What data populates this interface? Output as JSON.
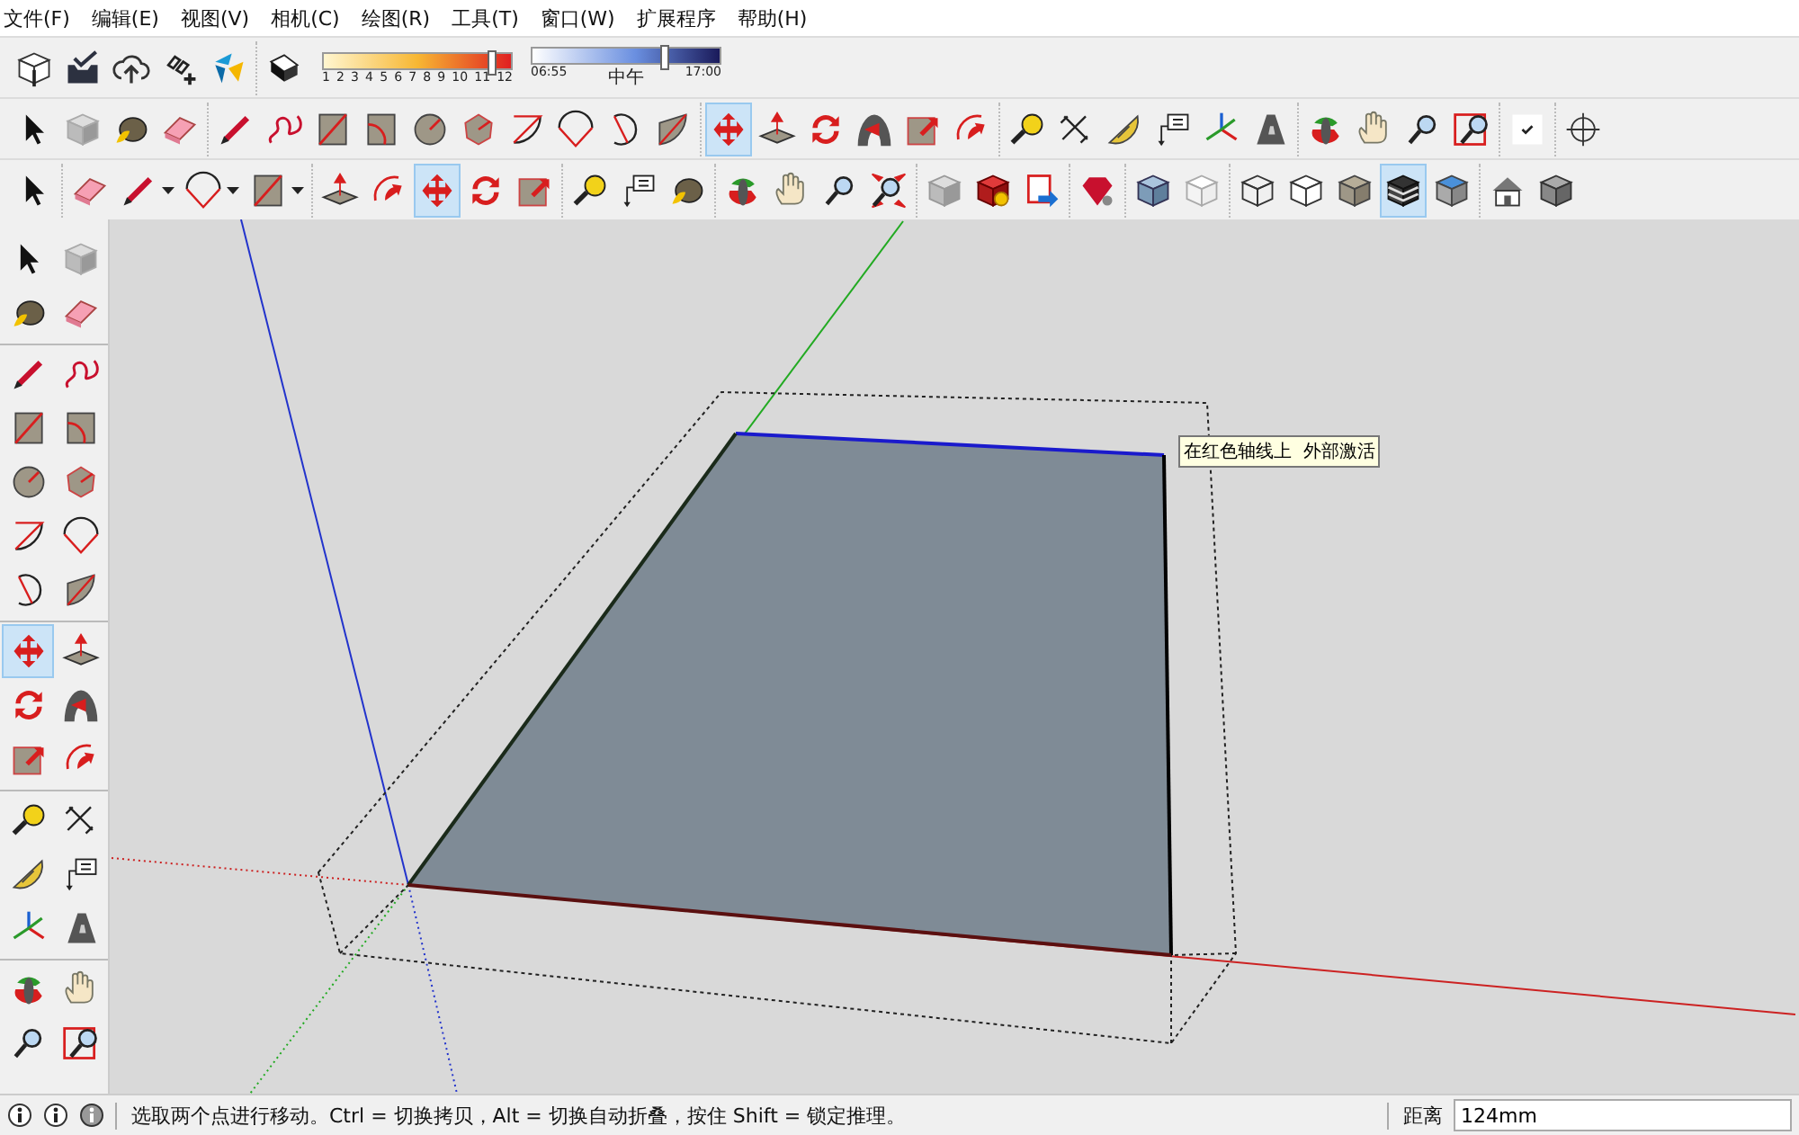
{
  "menu": [
    "文件(F)",
    "编辑(E)",
    "视图(V)",
    "相机(C)",
    "绘图(R)",
    "工具(T)",
    "窗口(W)",
    "扩展程序",
    "帮助(H)"
  ],
  "top_toolbars": [
    {
      "groups": [
        [
          {
            "kind": "download"
          },
          {
            "kind": "checklist"
          },
          {
            "kind": "cloud"
          },
          {
            "kind": "link"
          },
          {
            "kind": "logo"
          }
        ],
        [
          {
            "kind": "shadow"
          }
        ]
      ],
      "shadow_settings": {
        "month_ticks": [
          "1",
          "2",
          "3",
          "4",
          "5",
          "6",
          "7",
          "8",
          "9",
          "10",
          "11",
          "12"
        ],
        "month_slider": {
          "level": 0.89
        },
        "time_slider": {
          "level": 0.7
        },
        "time_start": "06:55",
        "time_mid": "中午",
        "time_end": "17:00"
      }
    },
    {
      "groups": [
        [
          {
            "kind": "select",
            "selected": false
          },
          {
            "kind": "component",
            "selected": false
          },
          {
            "kind": "paint",
            "selected": false
          },
          {
            "kind": "eraser",
            "selected": false
          }
        ],
        [
          {
            "kind": "pencil",
            "selected": false
          },
          {
            "kind": "freehand",
            "selected": false
          },
          {
            "kind": "rectangle",
            "selected": false
          },
          {
            "kind": "rotrect",
            "selected": false
          },
          {
            "kind": "circle",
            "selected": false
          },
          {
            "kind": "polygon",
            "selected": false
          },
          {
            "kind": "arc",
            "selected": false
          },
          {
            "kind": "arc2",
            "selected": false
          },
          {
            "kind": "arc3",
            "selected": false
          },
          {
            "kind": "pie",
            "selected": false
          }
        ],
        [
          {
            "kind": "move",
            "selected": true
          },
          {
            "kind": "pushpull",
            "selected": false
          },
          {
            "kind": "rotate",
            "selected": false
          },
          {
            "kind": "followme",
            "selected": false
          },
          {
            "kind": "scale",
            "selected": false
          },
          {
            "kind": "offset",
            "selected": false
          }
        ],
        [
          {
            "kind": "tape",
            "selected": false
          },
          {
            "kind": "dimension",
            "selected": false
          },
          {
            "kind": "protractor",
            "selected": false
          },
          {
            "kind": "text",
            "selected": false
          },
          {
            "kind": "axes",
            "selected": false
          },
          {
            "kind": "text3d",
            "selected": false
          }
        ],
        [
          {
            "kind": "orbit",
            "selected": false
          },
          {
            "kind": "pan",
            "selected": false
          },
          {
            "kind": "zoom",
            "selected": false
          },
          {
            "kind": "zoomwindow",
            "selected": false
          }
        ],
        [
          {
            "kind": "check",
            "selected": false
          }
        ],
        [
          {
            "kind": "crosshair",
            "selected": false
          }
        ]
      ]
    },
    {
      "groups": [
        [
          {
            "kind": "select",
            "selected": false
          }
        ],
        [
          {
            "kind": "eraser",
            "selected": false
          },
          {
            "kind": "pencil",
            "selected": false,
            "dropdown": true
          },
          {
            "kind": "arc2",
            "selected": false,
            "dropdown": true
          },
          {
            "kind": "rectangle",
            "selected": false,
            "dropdown": true
          }
        ],
        [
          {
            "kind": "pushpull",
            "selected": false
          },
          {
            "kind": "offset",
            "selected": false
          },
          {
            "kind": "move",
            "selected": true
          },
          {
            "kind": "rotate",
            "selected": false
          },
          {
            "kind": "scale",
            "selected": false
          }
        ],
        [
          {
            "kind": "tape",
            "selected": false
          },
          {
            "kind": "text",
            "selected": false
          },
          {
            "kind": "paint",
            "selected": false
          }
        ],
        [
          {
            "kind": "orbit",
            "selected": false
          },
          {
            "kind": "pan",
            "selected": false
          },
          {
            "kind": "zoom",
            "selected": false
          },
          {
            "kind": "zoomextents",
            "selected": false
          }
        ],
        [
          {
            "kind": "warehouse",
            "selected": false
          },
          {
            "kind": "extwarehouse",
            "selected": false
          },
          {
            "kind": "send",
            "selected": false
          }
        ],
        [
          {
            "kind": "gem",
            "selected": false
          }
        ],
        [
          {
            "kind": "xray",
            "selected": false
          },
          {
            "kind": "backedges",
            "selected": false
          }
        ],
        [
          {
            "kind": "wireframe",
            "selected": false
          },
          {
            "kind": "hiddenline",
            "selected": false
          },
          {
            "kind": "shaded",
            "selected": false
          },
          {
            "kind": "textured",
            "selected": true
          },
          {
            "kind": "monochrome",
            "selected": false
          }
        ],
        [
          {
            "kind": "house",
            "selected": false
          },
          {
            "kind": "cubes",
            "selected": false
          }
        ]
      ]
    }
  ],
  "left_toolbar": {
    "groups": [
      [
        {
          "kind": "select",
          "selected": false
        },
        {
          "kind": "component",
          "selected": false
        },
        {
          "kind": "paint",
          "selected": false
        },
        {
          "kind": "eraser",
          "selected": false
        }
      ],
      [
        {
          "kind": "pencil",
          "selected": false
        },
        {
          "kind": "freehand",
          "selected": false
        },
        {
          "kind": "rectangle",
          "selected": false
        },
        {
          "kind": "rotrect",
          "selected": false
        },
        {
          "kind": "circle",
          "selected": false
        },
        {
          "kind": "polygon",
          "selected": false
        },
        {
          "kind": "arc",
          "selected": false
        },
        {
          "kind": "arc2",
          "selected": false
        },
        {
          "kind": "arc3",
          "selected": false
        },
        {
          "kind": "pie",
          "selected": false
        }
      ],
      [
        {
          "kind": "move",
          "selected": true
        },
        {
          "kind": "pushpull",
          "selected": false
        },
        {
          "kind": "rotate",
          "selected": false
        },
        {
          "kind": "followme",
          "selected": false
        },
        {
          "kind": "scale",
          "selected": false
        },
        {
          "kind": "offset",
          "selected": false
        }
      ],
      [
        {
          "kind": "tape",
          "selected": false
        },
        {
          "kind": "dimension",
          "selected": false
        },
        {
          "kind": "protractor",
          "selected": false
        },
        {
          "kind": "text",
          "selected": false
        },
        {
          "kind": "axes",
          "selected": false
        },
        {
          "kind": "text3d",
          "selected": false
        }
      ],
      [
        {
          "kind": "orbit",
          "selected": false
        },
        {
          "kind": "pan",
          "selected": false
        },
        {
          "kind": "zoom",
          "selected": false
        },
        {
          "kind": "zoomwindow",
          "selected": false
        }
      ]
    ]
  },
  "viewport": {
    "tooltip": "在红色轴线上  外部激活"
  },
  "status_bar": {
    "message": "选取两个点进行移动。Ctrl = 切换拷贝，Alt = 切换自动折叠，按住 Shift = 锁定推理。",
    "measure_label": "距离",
    "measure_value": "124mm"
  }
}
